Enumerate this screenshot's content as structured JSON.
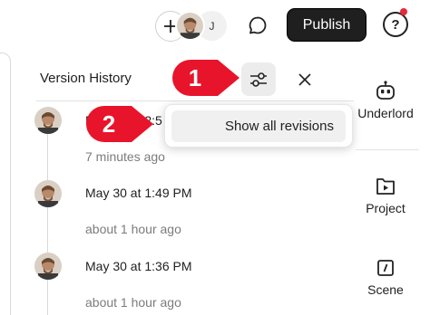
{
  "topbar": {
    "collaborator_initial": "J",
    "publish_label": "Publish",
    "help_label": "?"
  },
  "panel": {
    "title": "Version History"
  },
  "dropdown": {
    "item_label": "Show all revisions"
  },
  "versions": [
    {
      "date": "May 30 at 2:5",
      "ago": "7 minutes ago"
    },
    {
      "date": "May 30 at 1:49 PM",
      "ago": "about 1 hour ago"
    },
    {
      "date": "May 30 at 1:36 PM",
      "ago": "about 1 hour ago"
    }
  ],
  "rail": {
    "items": [
      {
        "label": "Underlord",
        "icon": "robot-icon"
      },
      {
        "label": "Project",
        "icon": "play-folder-icon"
      },
      {
        "label": "Scene",
        "icon": "scene-icon"
      }
    ]
  },
  "annotations": {
    "badge_1": "1",
    "badge_2": "2"
  },
  "colors": {
    "annotation_red": "#e8142b",
    "publish_bg": "#1f1f1f",
    "notification_dot": "#e5293a"
  }
}
